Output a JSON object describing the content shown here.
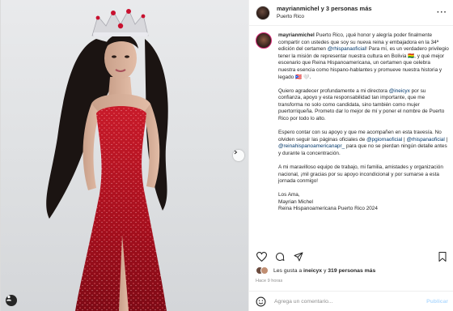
{
  "post": {
    "header": {
      "user": "mayrianmichel y 3 personas más",
      "location": "Puerto Rico",
      "more_icon": "more-horizontal-icon"
    },
    "caption": {
      "username": "mayrianmichel",
      "p1": "Puerto Rico, ¡qué honor y alegría poder finalmente compartir con ustedes que soy su nueva reina y embajadora en la 34ª edición del certamen ",
      "p1_mention": "@rhispanaoficial",
      "p1_rest": "! Para mí, es un verdadero privilegio tener la misión de representar nuestra cultura en Bolivia 🇧🇴, y qué mejor escenario que Reina Hispanoamericana, un certamen que celebra nuestra esencia como hispano-hablantes y promueve nuestra historia y legado 🇵🇷 🤍.",
      "p2_a": "Quiero agradecer profundamente a mi directora ",
      "p2_mention": "@ineicyx",
      "p2_b": " por su confianza, apoyo y esta responsabilidad tan importante, que me transforma no solo como candidata, sino también como mujer puertorriqueña. Prometo dar lo mejor de mí y poner el nombre de Puerto Rico por todo lo alto.",
      "p3_a": "Espero contar con su apoyo y que me acompañen en esta travesía. No olviden seguir las páginas oficiales de ",
      "p3_m1": "@pgiornaoficial",
      "p3_sep1": " | ",
      "p3_m2": "@rhispanaoficial",
      "p3_sep2": " | ",
      "p3_m3": "@reinahispanoamericanapr_",
      "p3_b": " para que no se pierdan ningún detalle antes y durante la concentración.",
      "p4": "A mi maravilloso equipo de trabajo, mi familia, amistades y organización nacional, ¡mil gracias por su apoyo incondicional y por sumarse a esta jornada conmigo!",
      "sign1": "Los Ama,",
      "sign2": "Mayrian Michel",
      "sign3": "Reina Hispanoamericana Puerto Rico 2024"
    },
    "actions": {
      "like_icon": "heart-icon",
      "comment_icon": "comment-icon",
      "share_icon": "send-icon",
      "save_icon": "bookmark-icon"
    },
    "likes_text": "Les gusta a ",
    "likes_user": "ineicyx",
    "likes_and": " y ",
    "likes_count": "319 personas más",
    "time": "Hace 9 horas",
    "comment_placeholder": "Agrega un comentario...",
    "publish_label": "Publicar"
  },
  "colors": {
    "link": "#00376b",
    "dress": "#b3121f",
    "publish": "#b3dbff"
  }
}
